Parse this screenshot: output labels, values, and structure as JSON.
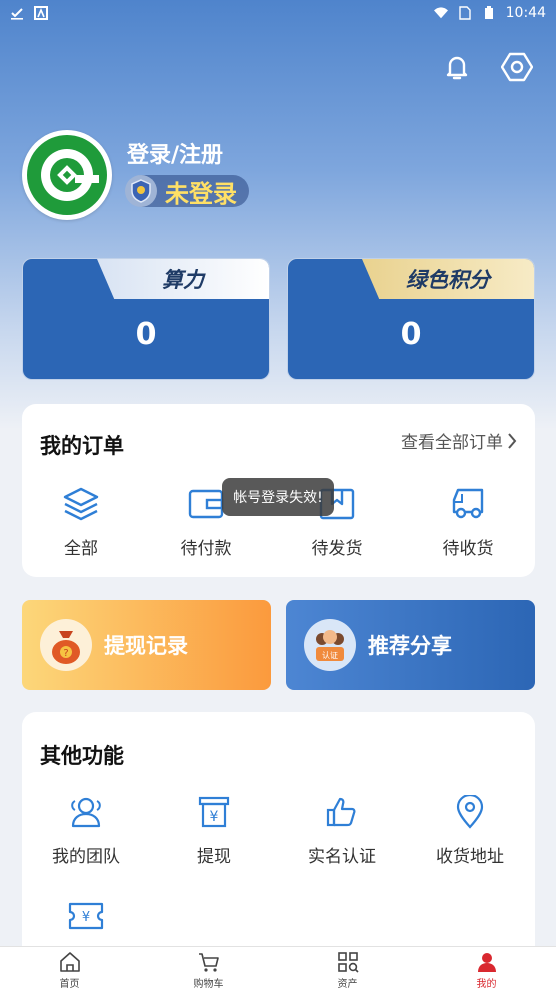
{
  "status_bar": {
    "time": "10:44"
  },
  "profile": {
    "login_label": "登录/注册",
    "badge_label": "未登录"
  },
  "stats": [
    {
      "label": "算力",
      "value": "0"
    },
    {
      "label": "绿色积分",
      "value": "0"
    }
  ],
  "orders": {
    "title": "我的订单",
    "view_all": "查看全部订单",
    "items": [
      {
        "label": "全部",
        "icon": "layers-icon"
      },
      {
        "label": "待付款",
        "icon": "wallet-icon"
      },
      {
        "label": "待发货",
        "icon": "box-icon"
      },
      {
        "label": "待收货",
        "icon": "truck-icon"
      }
    ]
  },
  "toast": "帐号登录失效!",
  "promos": [
    {
      "label": "提现记录",
      "icon": "money-bag-icon"
    },
    {
      "label": "推荐分享",
      "icon": "share-people-icon"
    }
  ],
  "other": {
    "title": "其他功能",
    "items": [
      {
        "label": "我的团队",
        "icon": "team-icon"
      },
      {
        "label": "提现",
        "icon": "withdraw-icon"
      },
      {
        "label": "实名认证",
        "icon": "thumbs-up-icon"
      },
      {
        "label": "收货地址",
        "icon": "location-icon"
      },
      {
        "label": "",
        "icon": "bill-icon"
      }
    ]
  },
  "bottom_nav": [
    {
      "label": "首页",
      "icon": "home-icon"
    },
    {
      "label": "购物车",
      "icon": "cart-icon"
    },
    {
      "label": "资产",
      "icon": "assets-icon"
    },
    {
      "label": "我的",
      "icon": "user-icon"
    }
  ],
  "colors": {
    "primary": "#2c66b5",
    "accent": "#d9282f",
    "icon_blue": "#2f7fd6"
  }
}
